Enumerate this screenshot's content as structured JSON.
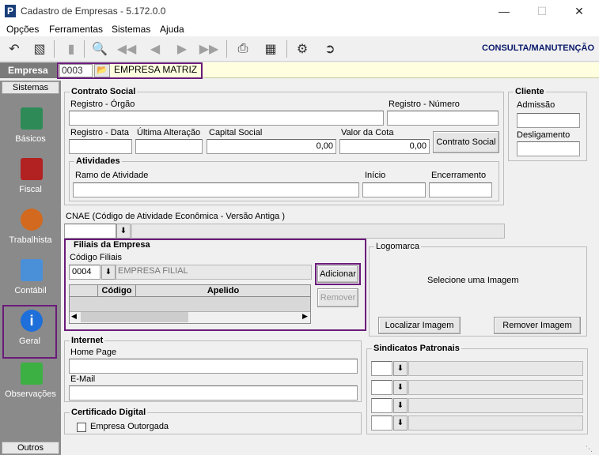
{
  "window": {
    "title": "Cadastro de Empresas - 5.172.0.0",
    "app_letter": "P"
  },
  "menu": [
    "Opções",
    "Ferramentas",
    "Sistemas",
    "Ajuda"
  ],
  "mode_label": "CONSULTA/MANUTENÇÃO",
  "empresa": {
    "label": "Empresa",
    "code": "0003",
    "name": "EMPRESA MATRIZ"
  },
  "sidebar": {
    "header": "Sistemas",
    "footer": "Outros",
    "items": [
      "Básicos",
      "Fiscal",
      "Trabalhista",
      "Contábil",
      "Geral",
      "Observações"
    ]
  },
  "contrato": {
    "legend": "Contrato Social",
    "registro_orgao_label": "Registro - Órgão",
    "registro_numero_label": "Registro - Número",
    "registro_data_label": "Registro - Data",
    "ultima_alteracao_label": "Última Alteração",
    "capital_social_label": "Capital Social",
    "capital_social_value": "0,00",
    "valor_cota_label": "Valor da Cota",
    "valor_cota_value": "0,00",
    "button": "Contrato Social"
  },
  "atividades": {
    "legend": "Atividades",
    "ramo_label": "Ramo de Atividade",
    "inicio_label": "Início",
    "encerramento_label": "Encerramento"
  },
  "cliente": {
    "legend": "Cliente",
    "admissao_label": "Admissão",
    "desligamento_label": "Desligamento"
  },
  "cnae": {
    "label": "CNAE (Código de Atividade Econômica - Versão Antiga )"
  },
  "filiais": {
    "legend": "Filiais da Empresa",
    "codigo_label": "Código Filiais",
    "codigo_value": "0004",
    "filial_name": "EMPRESA FILIAL",
    "add_button": "Adicionar",
    "remove_button": "Remover",
    "col_codigo": "Código",
    "col_apelido": "Apelido"
  },
  "logomarca": {
    "legend": "Logomarca",
    "placeholder": "Selecione  uma   Imagem",
    "localizar_button": "Localizar Imagem",
    "remover_button": "Remover Imagem"
  },
  "internet": {
    "legend": "Internet",
    "home_label": "Home Page",
    "email_label": "E-Mail"
  },
  "certificado": {
    "legend": "Certificado Digital",
    "checkbox_label": "Empresa Outorgada"
  },
  "sindicatos": {
    "legend": "Sindicatos Patronais"
  },
  "colors": {
    "highlight": "#6a1b7a",
    "sidebar_bg": "#8a8a8a",
    "empresa_bg": "#ffffe0",
    "mode_label": "#0a1a6a"
  }
}
